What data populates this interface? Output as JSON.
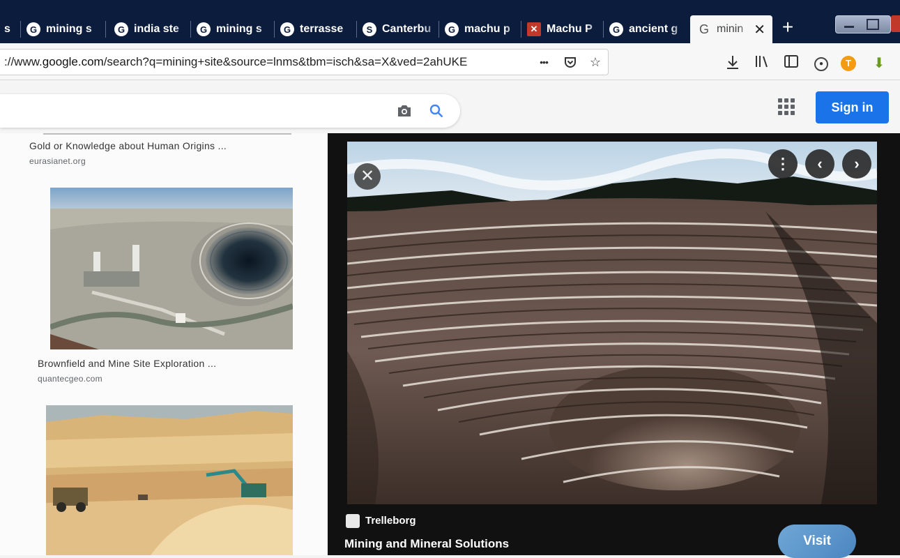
{
  "browser": {
    "tabs": [
      {
        "label": "s",
        "favicon": "google-g"
      },
      {
        "label": "mining s",
        "favicon": "google-g"
      },
      {
        "label": "india ste",
        "favicon": "google-g"
      },
      {
        "label": "mining s",
        "favicon": "google-g"
      },
      {
        "label": "terrasse",
        "favicon": "google-g"
      },
      {
        "label": "Canterbu",
        "favicon": "site-s"
      },
      {
        "label": "machu p",
        "favicon": "google-g"
      },
      {
        "label": "Machu P",
        "favicon": "site-red"
      },
      {
        "label": "ancient g",
        "favicon": "google-g"
      },
      {
        "label": "minin",
        "favicon": "google-g",
        "active": true
      }
    ],
    "new_tab_glyph": "+",
    "close_glyph": "✕",
    "url_prefix": "://www.",
    "url_host": "google.com",
    "url_path": "/search?q=mining+site&source=lnms&tbm=isch&sa=X&ved=2ahUKE",
    "page_actions_glyph": "•••"
  },
  "google": {
    "sign_in_label": "Sign in",
    "accent_color": "#1a73e8"
  },
  "results": [
    {
      "title": "Gold or Knowledge about Human Origins ...",
      "source": "eurasianet.org"
    },
    {
      "title": "Brownfield and Mine Site Exploration ...",
      "source": "quantecgeo.com"
    }
  ],
  "preview": {
    "source_name": "Trelleborg",
    "title": "Mining and Mineral Solutions",
    "visit_label": "Visit",
    "close_glyph": "✕",
    "more_glyph": "⋮",
    "prev_glyph": "‹",
    "next_glyph": "›"
  }
}
